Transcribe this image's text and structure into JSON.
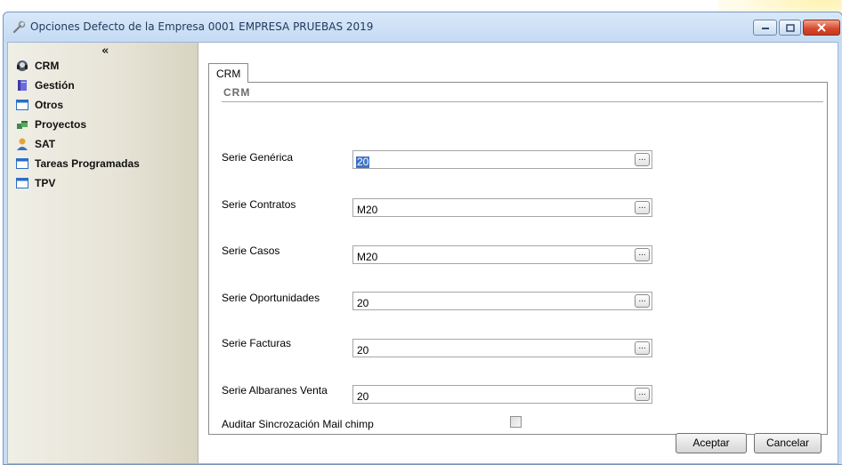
{
  "window": {
    "title": "Opciones Defecto de la Empresa 0001 EMPRESA PRUEBAS 2019",
    "icon": "wrench-icon",
    "controls": [
      "minimize",
      "maximize",
      "close"
    ]
  },
  "sidebar": {
    "collapse_label": "«",
    "items": [
      {
        "label": "CRM",
        "icon": "headset-icon"
      },
      {
        "label": "Gestión",
        "icon": "book-icon"
      },
      {
        "label": "Otros",
        "icon": "window-icon"
      },
      {
        "label": "Proyectos",
        "icon": "cubes-icon"
      },
      {
        "label": "SAT",
        "icon": "user-icon"
      },
      {
        "label": "Tareas Programadas",
        "icon": "window-icon"
      },
      {
        "label": "TPV",
        "icon": "window-icon"
      }
    ]
  },
  "tab": {
    "label": "CRM",
    "group_label": "CRM"
  },
  "fields": [
    {
      "label": "Serie Genérica",
      "value": "20",
      "selected": true
    },
    {
      "label": "Serie Contratos",
      "value": "M20",
      "selected": false
    },
    {
      "label": "Serie Casos",
      "value": "M20",
      "selected": false
    },
    {
      "label": "Serie Oportunidades",
      "value": "20",
      "selected": false
    },
    {
      "label": "Serie Facturas",
      "value": "20",
      "selected": false
    },
    {
      "label": "Serie Albaranes Venta",
      "value": "20",
      "selected": false
    }
  ],
  "lookup_button_label": "...",
  "checkbox": {
    "label": "Auditar Sincrozación Mail chimp",
    "checked": false
  },
  "buttons": {
    "accept": "Aceptar",
    "cancel": "Cancelar"
  },
  "colors": {
    "title_bar": "#c4daf3",
    "selection": "#3c74c8",
    "close_button": "#d6452b"
  }
}
